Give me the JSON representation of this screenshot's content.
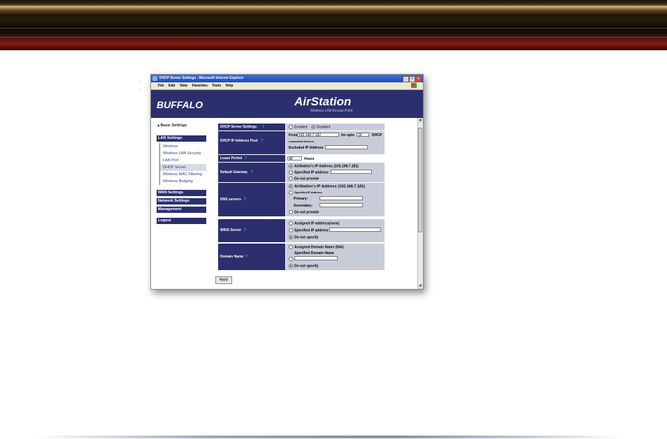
{
  "window": {
    "title": "DHCP Server Settings - Microsoft Internet Explorer",
    "menu": [
      "File",
      "Edit",
      "View",
      "Favorites",
      "Tools",
      "Help"
    ],
    "buttons": {
      "minimize": "_",
      "maximize": "□",
      "close": "×"
    }
  },
  "bullets": [
    "·",
    "·"
  ],
  "header": {
    "logo": "BUFFALO",
    "product": "AirStation",
    "subtitle": "Wireless LAN Access Point"
  },
  "sidebar": {
    "basic": "▲Basic Settings",
    "lan": "LAN Settings",
    "lan_items": [
      "Wireless",
      "Wireless LAN Security",
      "LAN Port",
      "DHCP Server",
      "Wireless MAC Filtering",
      "Wireless Bridging"
    ],
    "wan": "WAN Settings",
    "network": "Network Settings",
    "management": "Management",
    "logout": "Logout"
  },
  "form": {
    "dhcp_server": {
      "label": "DHCP Server Settings",
      "enabled": "Enabled",
      "disabled": "Disabled"
    },
    "pool": {
      "label": "DHCP IP Address Pool",
      "from": "From",
      "from_value": "192.168.7.182",
      "for_upto": "for upto",
      "count": "16",
      "dhcp": "DHCP",
      "connected": "connected devices",
      "excluded": "Excluded IP Address"
    },
    "lease": {
      "label": "Lease Period",
      "value": "48",
      "unit": "Hours"
    },
    "gateway": {
      "label": "Default Gateway",
      "opt1": "AirStation's IP Address (192.168.7.181)",
      "opt2": "Specified IP address",
      "opt3": "Do not provide"
    },
    "dns": {
      "label": "DNS servers",
      "opt1": "AirStation's IP Address (192.168.7.181)",
      "opt2": "Specified IP Address",
      "primary": "Primary:",
      "secondary": "Secondary:",
      "opt3": "Do not provide"
    },
    "wins": {
      "label": "WINS Server",
      "opt1": "Assigned IP address(none)",
      "opt2": "Specified IP address",
      "opt3": "Do not specify"
    },
    "domain": {
      "label": "Domain Name",
      "opt1": "Assigned Domain Name (N/A)",
      "opt2": "Specified Domain Name",
      "opt3": "Do not specify"
    },
    "help": "?",
    "apply": "Apply"
  }
}
